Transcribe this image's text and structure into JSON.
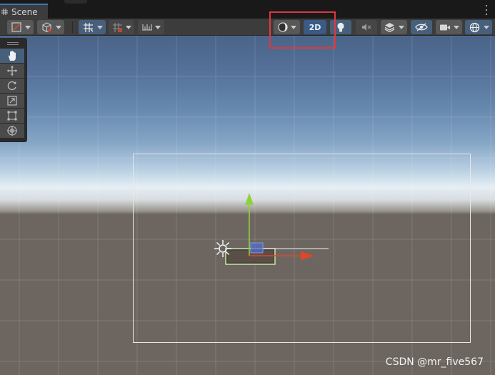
{
  "tab": {
    "label": "Scene",
    "icon": "scene-grid-icon"
  },
  "toolbar": {
    "left": [
      {
        "name": "draw-mode-button",
        "icon": "draw-mode-icon"
      },
      {
        "name": "render-pipeline-button",
        "icon": "cube-icon"
      },
      {
        "name": "grid-toggle-button",
        "icon": "grid-snap-icon",
        "active": true
      },
      {
        "name": "snap-increment-button",
        "icon": "snap-icon"
      },
      {
        "name": "ruler-button",
        "icon": "ruler-icon"
      }
    ],
    "right": [
      {
        "name": "shading-mode-button",
        "icon": "shading-sphere-icon"
      },
      {
        "name": "2d-mode-button",
        "label": "2D",
        "active": true
      },
      {
        "name": "lighting-toggle-button",
        "icon": "lightbulb-icon",
        "active": true
      },
      {
        "name": "audio-toggle-button",
        "icon": "speaker-muted-icon"
      },
      {
        "name": "effects-button",
        "icon": "layers-icon"
      },
      {
        "name": "visibility-button",
        "icon": "eye-crossed-icon",
        "active": true
      },
      {
        "name": "camera-button",
        "icon": "camera-icon"
      },
      {
        "name": "gizmos-button",
        "icon": "globe-icon",
        "active": true
      }
    ]
  },
  "tools": [
    {
      "name": "hand-tool",
      "icon": "hand-icon",
      "active": true
    },
    {
      "name": "move-tool",
      "icon": "move-arrows-icon"
    },
    {
      "name": "rotate-tool",
      "icon": "rotate-icon"
    },
    {
      "name": "scale-tool",
      "icon": "scale-icon"
    },
    {
      "name": "rect-tool",
      "icon": "rect-icon"
    },
    {
      "name": "transform-tool",
      "icon": "transform-icon"
    }
  ],
  "colors": {
    "accent_blue": "#46607c",
    "highlight_red": "#e0373f",
    "axis_y": "#8fd13f",
    "axis_x": "#e0462a",
    "selection": "#c6e6a1"
  },
  "watermark": "CSDN @mr_five567"
}
